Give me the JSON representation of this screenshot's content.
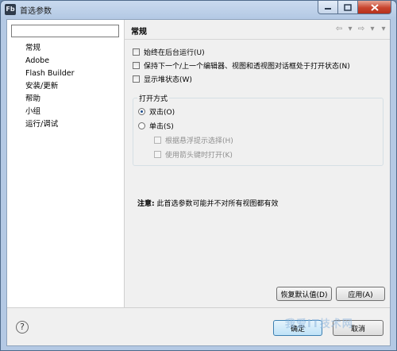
{
  "window": {
    "title": "首选参数",
    "app_icon": "Fb",
    "controls": [
      "minimize-icon",
      "maximize-icon",
      "close-icon"
    ]
  },
  "sidebar": {
    "filter": {
      "value": "",
      "placeholder": ""
    },
    "items": [
      {
        "label": "常规",
        "selected": true
      },
      {
        "label": "Adobe"
      },
      {
        "label": "Flash Builder"
      },
      {
        "label": "安装/更新"
      },
      {
        "label": "帮助"
      },
      {
        "label": "小组"
      },
      {
        "label": "运行/调试"
      }
    ]
  },
  "page": {
    "title": "常规",
    "nav_icons": [
      "back-arrow-icon",
      "back-menu-icon",
      "forward-arrow-icon",
      "forward-menu-icon",
      "view-menu-icon"
    ],
    "checkboxes": [
      {
        "label": "始终在后台运行(U)",
        "checked": false
      },
      {
        "label": "保持下一个/上一个编辑器、视图和透视图对话框处于打开状态(N)",
        "checked": false
      },
      {
        "label": "显示堆状态(W)",
        "checked": false
      }
    ],
    "open_mode": {
      "label": "打开方式",
      "double_click": "双击(O)",
      "single_click": "单击(S)",
      "selected": "double_click",
      "sub_options": [
        {
          "label": "根据悬浮提示选择(H)",
          "enabled": false
        },
        {
          "label": "使用箭头键时打开(K)",
          "enabled": false
        }
      ]
    },
    "note_label": "注意:",
    "note_text": " 此首选参数可能并不对所有视图都有效",
    "restore_defaults": "恢复默认值(D)",
    "apply": "应用(A)"
  },
  "footer": {
    "help_glyph": "?",
    "ok": "确定",
    "cancel": "取消"
  },
  "watermark": "我爱IT技术网"
}
